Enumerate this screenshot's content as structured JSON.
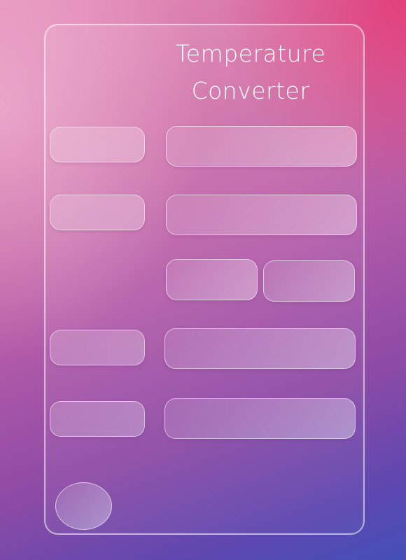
{
  "app": {
    "title_line1": "Temperature",
    "title_line2": "Converter"
  },
  "colors": {
    "background_top_right": "#e33c78",
    "background_top_left": "#e8a0c4",
    "background_bottom": "#4450b8",
    "card_border": "#ffffff"
  }
}
